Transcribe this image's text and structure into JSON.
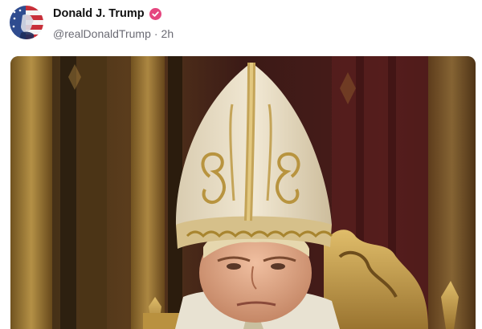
{
  "post": {
    "author": {
      "display_name": "Donald J. Trump",
      "handle": "@realDonaldTrump",
      "separator": "·",
      "time_ago": "2h",
      "verified": true
    },
    "media": {
      "type": "image"
    }
  },
  "colors": {
    "verified_badge": "#e5467f",
    "handle_text": "#6b6b74",
    "name_text": "#111111"
  },
  "icons": {
    "verified": "verified-badge-icon",
    "avatar": "flag-portrait-avatar"
  }
}
